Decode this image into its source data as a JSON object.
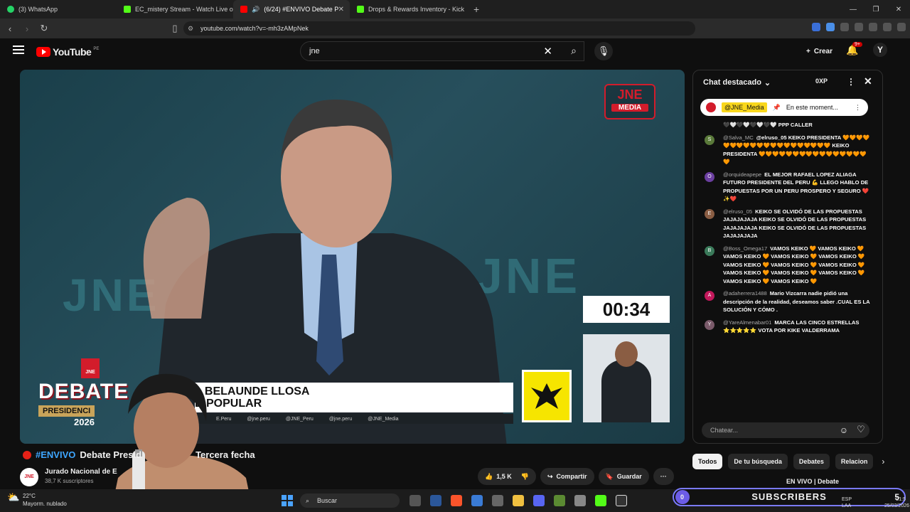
{
  "browser": {
    "tabs": [
      {
        "label": "(3) WhatsApp",
        "color": "#25d366"
      },
      {
        "label": "EC_mistery Stream - Watch Live on K",
        "color": "#53fc18"
      },
      {
        "label": "(6/24) #ENVIVO Debate P",
        "color": "#ff0000"
      },
      {
        "label": "Drops & Rewards Inventory - Kick St",
        "color": "#53fc18"
      }
    ],
    "url": "youtube.com/watch?v=-mh3zAMpNek"
  },
  "youtube": {
    "logo": "YouTube",
    "region": "PE",
    "search_value": "jne",
    "create_label": "Crear",
    "notif_count": "9+"
  },
  "video": {
    "jne_logo_top": "JNE",
    "jne_logo_bottom": "MEDIA",
    "timer": "00:34",
    "debate_word": "DEBATE",
    "presidential": "PRESIDENCI",
    "year": "2026",
    "candidate_line1": "L BELAUNDE LLOSA",
    "candidate_line2": "D POPULAR",
    "handles": [
      "E.Peru",
      "@jne.peru",
      "@JNE_Peru",
      "@jne.peru",
      "@JNE_Media"
    ],
    "bg_text": "JNE"
  },
  "meta": {
    "live_tag": "#ENVIVO",
    "title_a": "Debate Presid",
    "title_b": "Tercera fecha",
    "channel": "Jurado Nacional de E",
    "subscribers": "38,7 K suscriptores",
    "likes": "1,5 K",
    "share": "Compartir",
    "save": "Guardar"
  },
  "chat": {
    "header": "Chat destacado",
    "points": "0XP",
    "pinned_mention": "@JNE_Media",
    "pinned_text": "En este moment...",
    "messages": [
      {
        "author": "",
        "text": "PPP CALLER",
        "avatar": ""
      },
      {
        "author": "@Salva_MC",
        "text": "@elruso_05 KEIKO PRESIDENTA",
        "extra": "KEIKO PRESIDENTA",
        "avatar": "S"
      },
      {
        "author": "@orquideapepe",
        "text": "EL MEJOR RAFAEL LOPEZ ALIAGA FUTURO PRESIDENTE DEL PERU",
        "extra": "LLEGO HABLO DE PROPUESTAS POR UN PERU PROSPERO Y SEGURO",
        "avatar": "O"
      },
      {
        "author": "@elruso_05",
        "text": "KEIKO SE OLVIDÓ DE LAS PROPUESTAS JAJAJAJAJA KEIKO SE OLVIDÓ DE LAS PROPUESTAS JAJAJAJAJA KEIKO SE OLVIDÓ DE LAS PROPUESTAS JAJAJAJAJA",
        "avatar": "E"
      },
      {
        "author": "@Boss_Omega17",
        "text": "VAMOS KEIKO",
        "avatar": "B"
      },
      {
        "author": "@adaherrera1488",
        "text": "Mario Vizcarra nadie pidió una descripción de la realidad, deseamos saber .CUAL ES LA SOLUCIÓN Y CÓMO .",
        "avatar": "A"
      },
      {
        "author": "@YareAlmenabar01",
        "text": "MARCA LAS CINCO ESTRELLAS",
        "extra": "VOTA POR KIKE VALDERRAMA",
        "avatar": "Y"
      }
    ],
    "input_placeholder": "Chatear..."
  },
  "chips": [
    "Todos",
    "De tu búsqueda",
    "Debates",
    "Relacion"
  ],
  "rec_title": "EN VIVO | Debate",
  "taskbar": {
    "temp": "22°C",
    "weather": "Mayorm. nublado",
    "search": "Buscar",
    "subs_count": "0",
    "subs_label": "SUBSCRIBERS",
    "subs_num": "5",
    "lang1": "ESP",
    "lang2": "LAA",
    "time": "21:5",
    "date": "25/03/2026"
  }
}
